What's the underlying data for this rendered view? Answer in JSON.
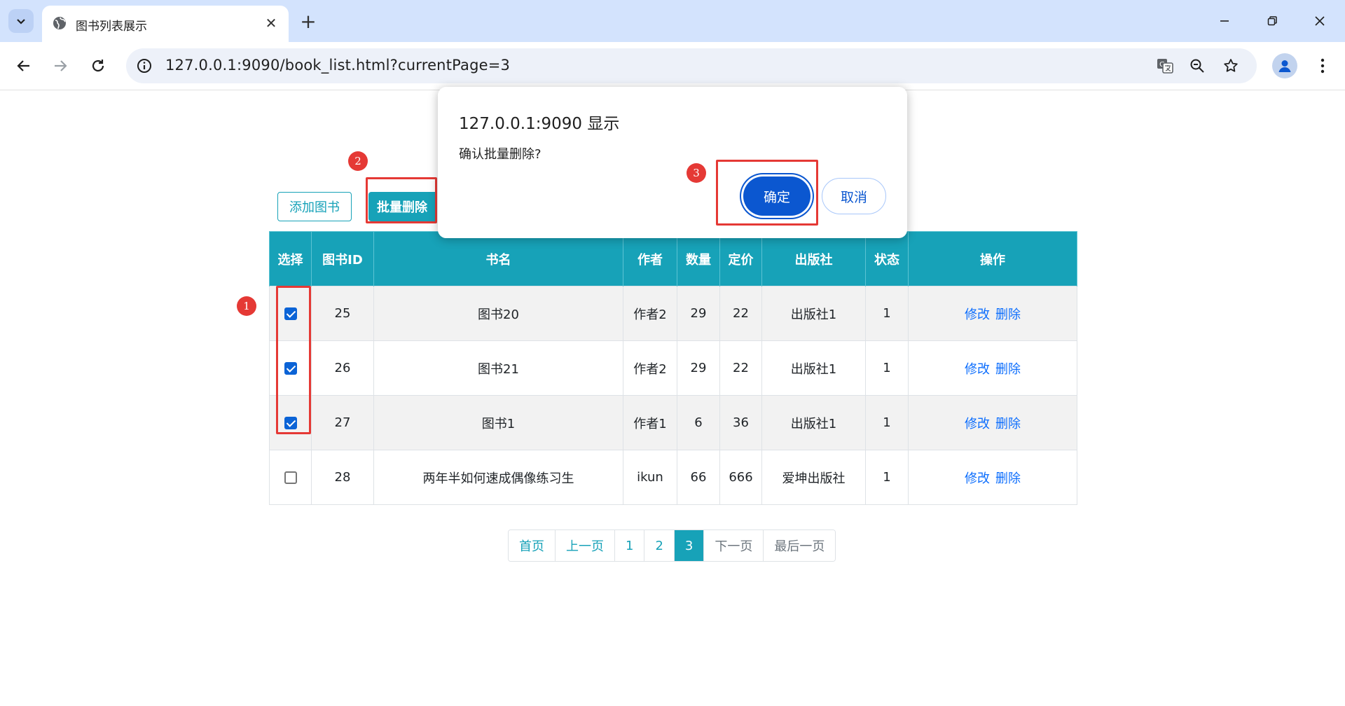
{
  "browser": {
    "tab_title": "图书列表展示",
    "tab_close": "✕",
    "new_tab": "+",
    "url": "127.0.0.1:9090/book_list.html?currentPage=3"
  },
  "page": {
    "add_button": "添加图书",
    "batch_delete_button": "批量删除",
    "columns": [
      "选择",
      "图书ID",
      "书名",
      "作者",
      "数量",
      "定价",
      "出版社",
      "状态",
      "操作"
    ],
    "rows": [
      {
        "checked": true,
        "id": "25",
        "name": "图书20",
        "author": "作者2",
        "count": "29",
        "price": "22",
        "publisher": "出版社1",
        "status": "1",
        "edit": "修改",
        "delete": "删除"
      },
      {
        "checked": true,
        "id": "26",
        "name": "图书21",
        "author": "作者2",
        "count": "29",
        "price": "22",
        "publisher": "出版社1",
        "status": "1",
        "edit": "修改",
        "delete": "删除"
      },
      {
        "checked": true,
        "id": "27",
        "name": "图书1",
        "author": "作者1",
        "count": "6",
        "price": "36",
        "publisher": "出版社1",
        "status": "1",
        "edit": "修改",
        "delete": "删除"
      },
      {
        "checked": false,
        "id": "28",
        "name": "两年半如何速成偶像练习生",
        "author": "ikun",
        "count": "66",
        "price": "666",
        "publisher": "爱坤出版社",
        "status": "1",
        "edit": "修改",
        "delete": "删除"
      }
    ],
    "pagination": [
      "首页",
      "上一页",
      "1",
      "2",
      "3",
      "下一页",
      "最后一页"
    ],
    "pagination_active": "3"
  },
  "annotations": {
    "badge_1": "1",
    "badge_2": "2",
    "badge_3": "3"
  },
  "dialog": {
    "title": "127.0.0.1:9090 显示",
    "message": "确认批量删除?",
    "ok": "确定",
    "cancel": "取消"
  },
  "colors": {
    "table_header": "#17a2b8",
    "annotation_red": "#e53935",
    "dialog_primary": "#0b57d0",
    "link": "#0d6efd"
  }
}
